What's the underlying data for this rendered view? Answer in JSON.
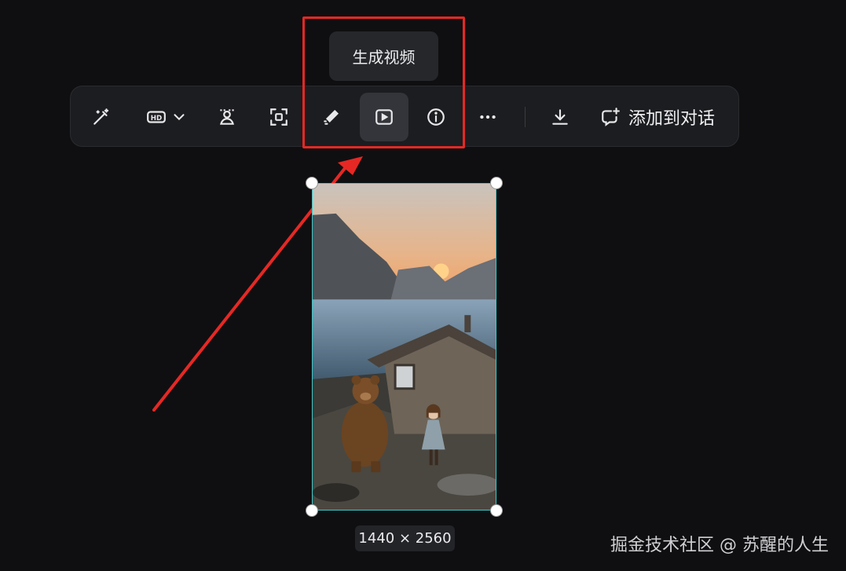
{
  "tooltip": {
    "text": "生成视频"
  },
  "toolbar": {
    "buttons": [
      {
        "name": "magic-wand",
        "icon": "magic-wand-icon"
      },
      {
        "name": "hd-upscale",
        "icon": "hd-icon"
      },
      {
        "name": "remove-background",
        "icon": "person-cutout-icon"
      },
      {
        "name": "expand-image",
        "icon": "expand-frame-icon"
      },
      {
        "name": "eraser",
        "icon": "eraser-icon"
      },
      {
        "name": "generate-video",
        "icon": "play-icon",
        "active": true
      },
      {
        "name": "info",
        "icon": "info-icon"
      },
      {
        "name": "more",
        "icon": "more-dots-icon"
      },
      {
        "name": "download",
        "icon": "download-icon"
      }
    ],
    "add_to_chat_label": "添加到对话"
  },
  "image": {
    "dimensions_label": "1440 × 2560"
  },
  "watermark": "掘金技术社区 @ 苏醒的人生",
  "colors": {
    "background": "#0f0f11",
    "toolbar_bg": "#1c1d20",
    "active_button": "#33353a",
    "annotation_red": "#e62824",
    "selection_border": "#3cc8c8"
  }
}
